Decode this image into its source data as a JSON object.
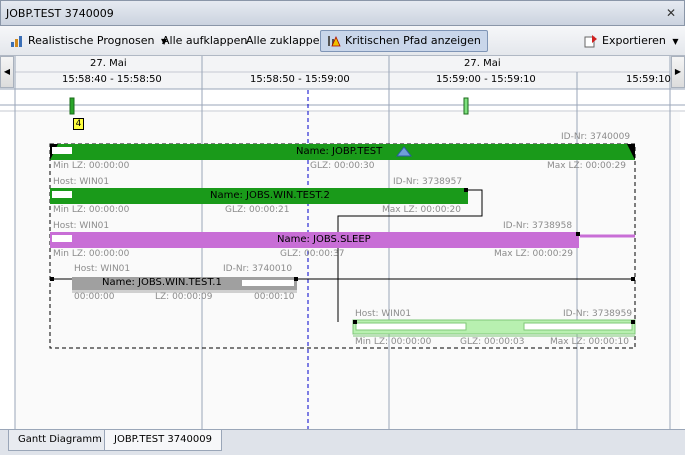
{
  "window": {
    "title": "JOBP.TEST 3740009"
  },
  "toolbar": {
    "prognose_label": "Realistische Prognosen",
    "expand_label": "Alle aufklappen",
    "collapse_label": "Alle zuklappen",
    "critical_path_label": "Kritischen Pfad anzeigen",
    "export_label": "Exportieren"
  },
  "timeline": {
    "date_left": "27. Mai",
    "date_right": "27. Mai",
    "time_ranges": [
      "15:58:40 - 15:58:50",
      "15:58:50 - 15:59:00",
      "15:59:00 - 15:59:10",
      "15:59:10"
    ]
  },
  "overview": {
    "count_badge": "4"
  },
  "jobs": {
    "jobp": {
      "id": "ID-Nr: 3740009",
      "name": "Name: JOBP.TEST",
      "min_lz": "Min LZ: 00:00:00",
      "glz": "GLZ: 00:00:30",
      "max_lz": "Max LZ: 00:00:29"
    },
    "win2": {
      "host": "Host: WIN01",
      "id": "ID-Nr: 3738957",
      "name": "Name: JOBS.WIN.TEST.2",
      "min_lz": "Min LZ: 00:00:00",
      "glz": "GLZ: 00:00:21",
      "max_lz": "Max LZ: 00:00:20"
    },
    "sleep": {
      "host": "Host: WIN01",
      "id": "ID-Nr: 3738958",
      "name": "Name: JOBS.SLEEP",
      "min_lz": "Min LZ: 00:00:00",
      "glz": "GLZ: 00:00:37",
      "max_lz": "Max LZ: 00:00:29"
    },
    "win1": {
      "host": "Host: WIN01",
      "id": "ID-Nr: 3740010",
      "name": "Name: JOBS.WIN.TEST.1",
      "min_lz": "00:00:00",
      "glz": "LZ: 00:00:09",
      "max_lz": "00:00:10"
    },
    "last": {
      "host": "Host: WIN01",
      "id": "ID-Nr: 3738959",
      "min_lz": "Min LZ: 00:00:00",
      "glz": "GLZ: 00:00:03",
      "max_lz": "Max LZ: 00:00:10"
    }
  },
  "tabs": [
    "Gantt Diagramm",
    "JOBP.TEST 3740009"
  ],
  "colors": {
    "green_bar": "#1a9a1a",
    "purple_bar": "#c86ed6",
    "gray_bar": "#a0a0a0",
    "light_green_bar": "#b8f0b0",
    "critical_line": "#0000cc"
  }
}
